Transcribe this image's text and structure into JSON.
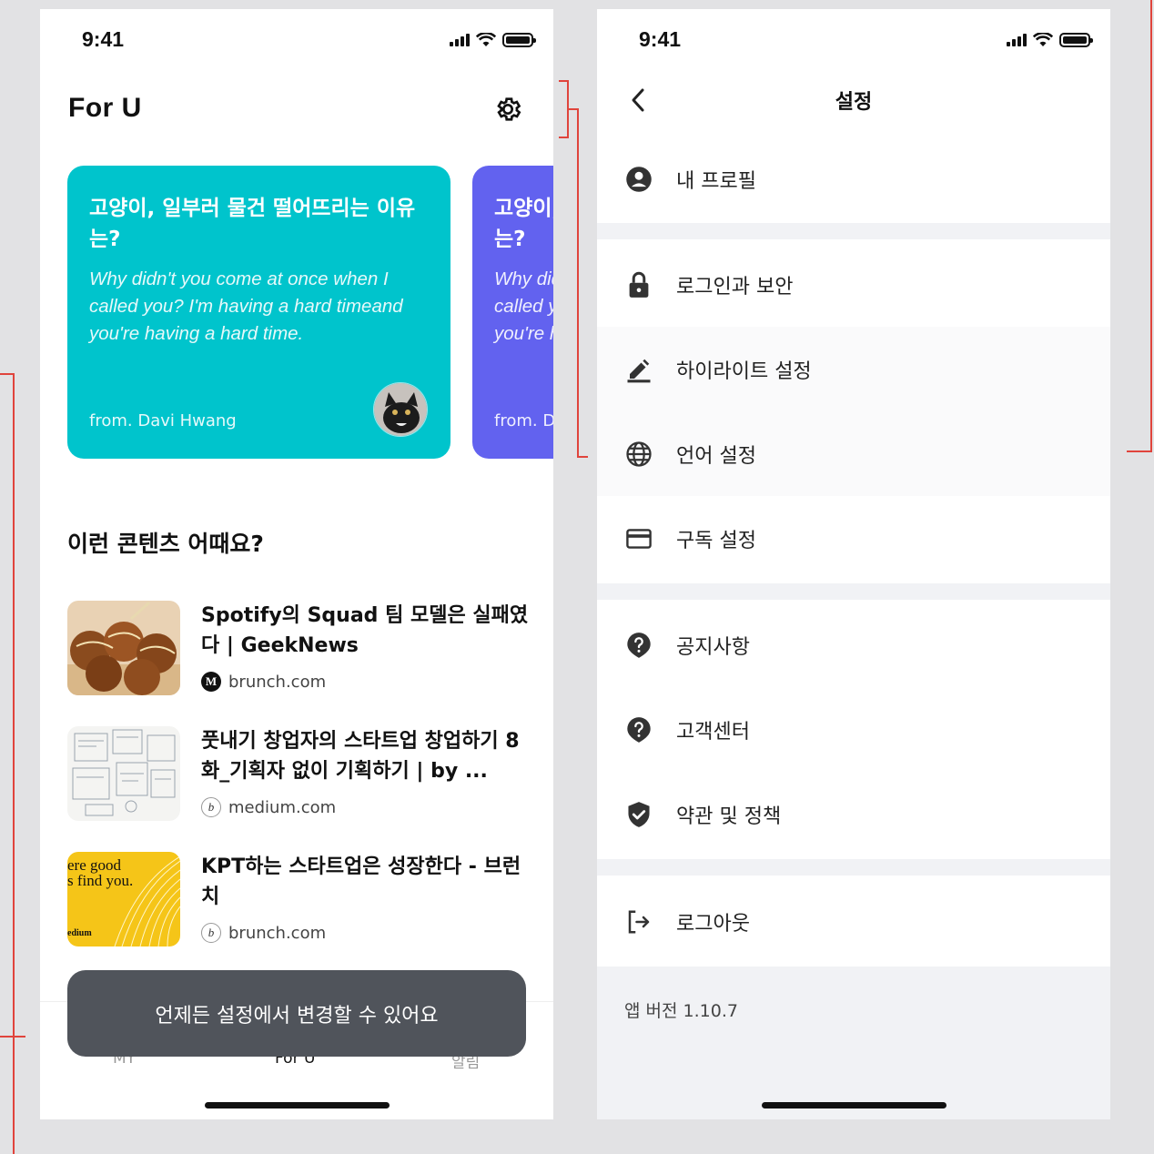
{
  "left": {
    "status_time": "9:41",
    "title": "For U",
    "cards": [
      {
        "title": "고양이, 일부러 물건 떨어뜨리는 이유는?",
        "body": "Why didn't you come at once when I called you? I'm having a hard timeand you're having a hard time.",
        "from": "from. Davi Hwang",
        "color": "#00c4cc"
      },
      {
        "title": "고양이, 일부러 물건 떨어뜨리는 이유는?",
        "body": "Why didn't you come at once when I called you? I'm having a hard timeand you're having a hard time.",
        "from": "from. Davi Hwang",
        "color": "#6262ef"
      }
    ],
    "section_title": "이런 콘텐츠 어때요?",
    "articles": [
      {
        "title": "Spotify의 Squad 팀 모델은 실패였다 | GeekNews",
        "source": "brunch.com",
        "source_icon": "medium-logo-icon"
      },
      {
        "title": "풋내기 창업자의 스타트업 창업하기 8화_기획자 없이 기획하기 | by ...",
        "source": "medium.com",
        "source_icon": "brunch-logo-icon"
      },
      {
        "title": "KPT하는 스타트업은 성장한다 - 브런치",
        "source": "brunch.com",
        "source_icon": "brunch-logo-icon"
      }
    ],
    "thumb3_text": "ere good\ns find you.",
    "thumb3_brand": "edium",
    "tabs": [
      "MY",
      "For U",
      "알림"
    ],
    "toast": "언제든 설정에서 변경할 수 있어요"
  },
  "right": {
    "status_time": "9:41",
    "nav_title": "설정",
    "groups": [
      [
        {
          "label": "내 프로필",
          "icon": "account-circle-icon"
        }
      ],
      [
        {
          "label": "로그인과 보안",
          "icon": "lock-icon"
        },
        {
          "label": "하이라이트 설정",
          "icon": "pen-icon"
        },
        {
          "label": "언어 설정",
          "icon": "globe-icon"
        },
        {
          "label": "구독 설정",
          "icon": "credit-card-icon"
        }
      ],
      [
        {
          "label": "공지사항",
          "icon": "help-bubble-icon"
        },
        {
          "label": "고객센터",
          "icon": "help-bubble-icon"
        },
        {
          "label": "약관 및 정책",
          "icon": "shield-check-icon"
        }
      ],
      [
        {
          "label": "로그아웃",
          "icon": "logout-icon"
        }
      ]
    ],
    "version": "앱 버전 1.10.7"
  },
  "colors": {
    "teal": "#00c4cc",
    "purple": "#6262ef",
    "toast": "#50545b",
    "annotation": "#e0443c"
  }
}
